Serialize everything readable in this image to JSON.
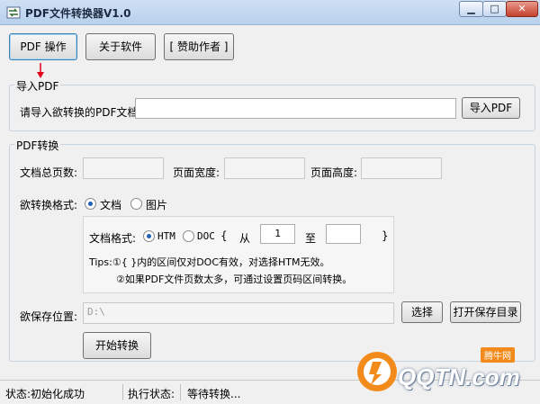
{
  "window": {
    "title": "PDF文件转换器V1.0",
    "minimize_glyph": "▁",
    "maximize_glyph": "□",
    "close_glyph": "✕"
  },
  "toolbar": {
    "pdf_ops_label": "PDF 操作",
    "about_label": "关于软件",
    "sponsor_label": "[ 赞助作者 ]"
  },
  "import_group": {
    "title": "导入PDF",
    "prompt_label": "请导入欲转换的PDF文档:",
    "path_value": "",
    "import_button": "导入PDF"
  },
  "convert_group": {
    "title": "PDF转换",
    "total_pages_label": "文档总页数:",
    "total_pages_value": "",
    "page_width_label": "页面宽度:",
    "page_width_value": "",
    "page_height_label": "页面高度:",
    "page_height_value": "",
    "target_format_label": "欲转换格式:",
    "format_options": [
      {
        "label": "文档",
        "checked": true
      },
      {
        "label": "图片",
        "checked": false
      }
    ],
    "doc_format_label": "文档格式:",
    "doc_format_options": [
      {
        "label": "HTM",
        "checked": true
      },
      {
        "label": "DOC",
        "checked": false
      }
    ],
    "brace_open": "{",
    "from_label": "从",
    "from_value": "1",
    "to_label": "至",
    "to_value": "",
    "brace_close": "}",
    "tips_line1": "Tips:①{ }内的区间仅对DOC有效，对选择HTM无效。",
    "tips_line2": "②如果PDF文件页数太多，可通过设置页码区间转换。",
    "save_location_label": "欲保存位置:",
    "save_path_value": "D:\\",
    "choose_button": "选择",
    "open_dir_button": "打开保存目录",
    "start_button": "开始转换"
  },
  "statusbar": {
    "status": "状态:初始化成功",
    "exec_label": "执行状态:",
    "exec_value": "等待转换..."
  },
  "watermark": {
    "brand": "QQTN.com",
    "tag": "腾牛网"
  },
  "colors": {
    "title_gradient_top": "#cfe0f3",
    "accent_red": "#e0001a",
    "radio_dot": "#1f5fb5",
    "watermark_orange": "#f28b1b"
  }
}
